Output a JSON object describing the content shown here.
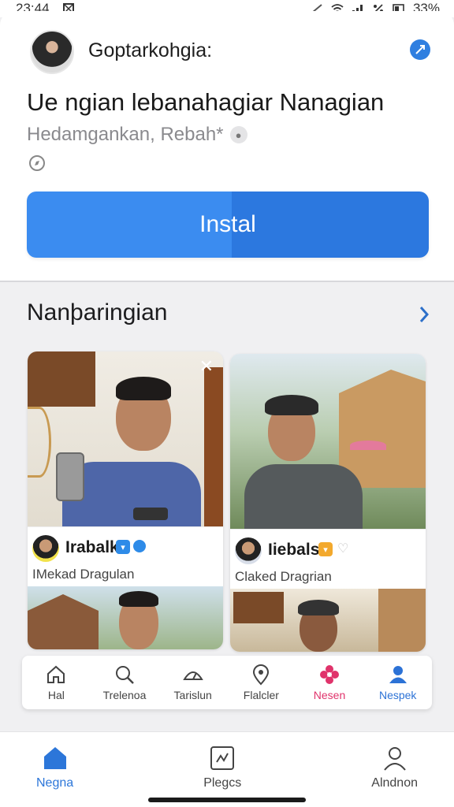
{
  "status_bar": {
    "time": "23:44",
    "battery": "33%"
  },
  "header": {
    "developer": "Goptarkohgia:",
    "app_title": "Ue ngian lebanahagiar Nanagian",
    "app_subtitle": "Hedamgankan, Rebah*",
    "install_label": "Instal"
  },
  "section": {
    "title": "Nanþaringian"
  },
  "cards": [
    {
      "name": "Irabalk",
      "desc": "IMekad Dragulan"
    },
    {
      "name": "Iiebals",
      "desc": "Claked Dragrian"
    }
  ],
  "tabs": [
    {
      "label": "Hal",
      "icon": "home-outline-icon"
    },
    {
      "label": "Trelenoa",
      "icon": "search-icon"
    },
    {
      "label": "Tarislun",
      "icon": "dashboard-icon"
    },
    {
      "label": "Flalcler",
      "icon": "location-pin-icon"
    },
    {
      "label": "Nesen",
      "icon": "flower-icon"
    },
    {
      "label": "Nespek",
      "icon": "person-icon"
    }
  ],
  "bottom_nav": [
    {
      "label": "Negna",
      "icon": "home-icon"
    },
    {
      "label": "Plegcs",
      "icon": "apps-icon"
    },
    {
      "label": "Alndnon",
      "icon": "account-icon"
    }
  ],
  "colors": {
    "accent": "#2f7fe0",
    "install": "#3b8cf0",
    "pink": "#e0336b"
  }
}
